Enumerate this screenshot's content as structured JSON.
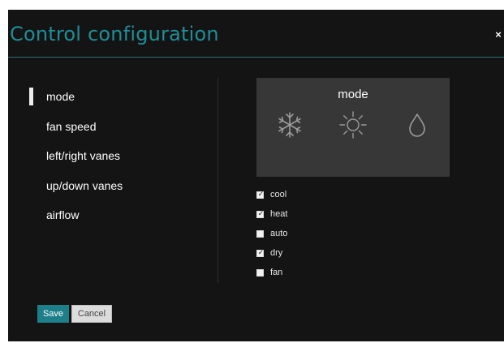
{
  "dialog": {
    "title": "Control configuration",
    "close_glyph": "×"
  },
  "nav": {
    "items": [
      {
        "label": "mode",
        "selected": true
      },
      {
        "label": "fan speed",
        "selected": false
      },
      {
        "label": "left/right vanes",
        "selected": false
      },
      {
        "label": "up/down vanes",
        "selected": false
      },
      {
        "label": "airflow",
        "selected": false
      }
    ]
  },
  "preview": {
    "title": "mode",
    "icons": [
      "snowflake-icon",
      "sun-icon",
      "droplet-icon"
    ]
  },
  "options": {
    "items": [
      {
        "label": "cool",
        "checked": true
      },
      {
        "label": "heat",
        "checked": true
      },
      {
        "label": "auto",
        "checked": false
      },
      {
        "label": "dry",
        "checked": true
      },
      {
        "label": "fan",
        "checked": false
      }
    ],
    "check_glyph": "✓"
  },
  "buttons": {
    "save_label": "Save",
    "cancel_label": "Cancel"
  },
  "colors": {
    "dialog_background": "#141414",
    "title_accent": "#1f8e96",
    "save_button": "#1c7f8a",
    "preview_panel": "#373737",
    "icon_stroke": "#9a9a9a"
  }
}
